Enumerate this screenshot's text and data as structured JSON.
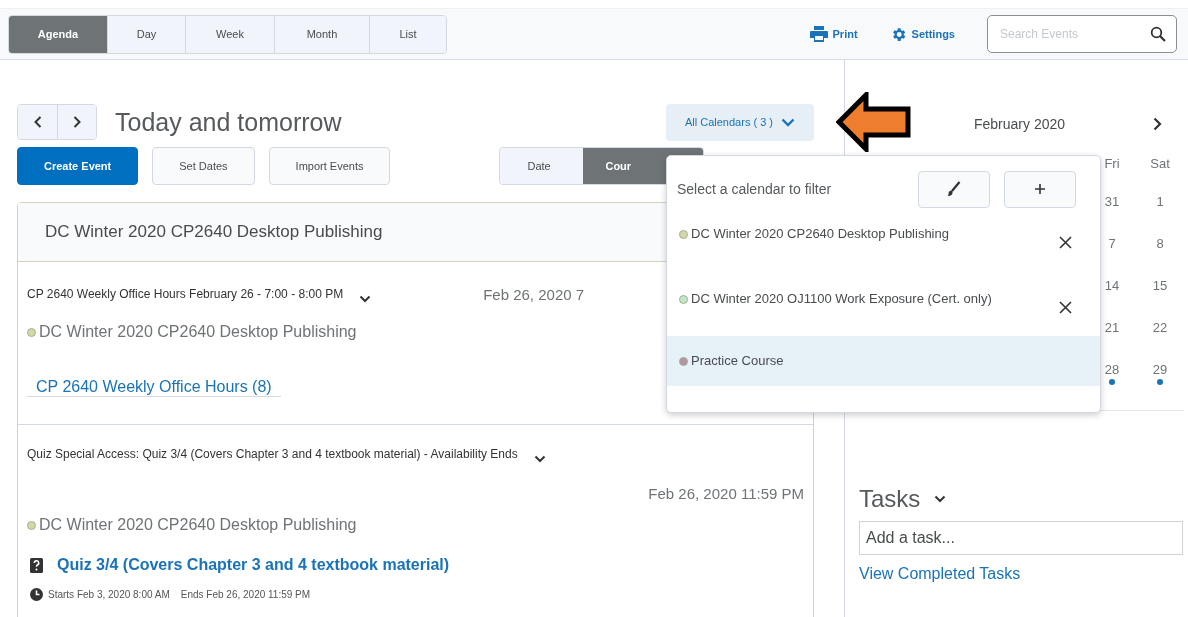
{
  "view_tabs": [
    {
      "label": "Agenda",
      "selected": true
    },
    {
      "label": "Day",
      "selected": false
    },
    {
      "label": "Week",
      "selected": false
    },
    {
      "label": "Month",
      "selected": false
    },
    {
      "label": "List",
      "selected": false
    }
  ],
  "toolbar": {
    "print": "Print",
    "settings": "Settings",
    "search_placeholder": "Search Events"
  },
  "heading": "Today and tomorrow",
  "calendars_button": "All Calendars ( 3 )",
  "actions": [
    {
      "label": "Create Event",
      "kind": "primary"
    },
    {
      "label": "Set Dates",
      "kind": "secondary"
    },
    {
      "label": "Import Events",
      "kind": "secondary"
    }
  ],
  "sort_tabs": [
    {
      "label": "Date",
      "selected": false
    },
    {
      "label": "Cour",
      "selected": true
    }
  ],
  "group": {
    "title": "DC Winter 2020 CP2640 Desktop Publishing",
    "events": [
      {
        "kind": "event",
        "title": "CP 2640 Weekly Office Hours February 26 - 7:00 - 8:00 PM",
        "date": "Feb 26, 2020 7",
        "calendar": "DC Winter 2020 CP2640 Desktop Publishing",
        "color": "#d4d9a3",
        "link": "CP 2640 Weekly Office Hours (8)"
      },
      {
        "kind": "quiz",
        "title": "Quiz Special Access: Quiz 3/4 (Covers Chapter 3 and 4 textbook material) - Availability Ends",
        "date": "Feb 26, 2020 11:59 PM",
        "calendar": "DC Winter 2020 CP2640 Desktop Publishing",
        "color": "#d4d9a3",
        "link": "Quiz 3/4 (Covers Chapter 3 and 4 textbook material)",
        "starts": "Starts Feb 3, 2020 8:00 AM",
        "ends": "Ends Feb 26, 2020 11:59 PM"
      }
    ]
  },
  "filter_popup": {
    "prompt": "Select a calendar to filter",
    "calendars": [
      {
        "name": "DC Winter 2020 CP2640 Desktop Publishing",
        "color": "#d4d9a3",
        "removable": true,
        "selected": false
      },
      {
        "name": "DC Winter 2020 OJ1100 Work Exposure (Cert. only)",
        "color": "#bfe8c6",
        "removable": true,
        "selected": false
      },
      {
        "name": "Practice Course",
        "color": "#b393a8",
        "removable": false,
        "selected": true
      }
    ]
  },
  "mini_calendar": {
    "month": "February 2020",
    "weekdays": [
      "Fri",
      "Sat"
    ],
    "weeks": [
      [
        {
          "day": "31",
          "has_events": false
        },
        {
          "day": "1",
          "has_events": false
        }
      ],
      [
        {
          "day": "7",
          "has_events": false
        },
        {
          "day": "8",
          "has_events": false
        }
      ],
      [
        {
          "day": "14",
          "has_events": false
        },
        {
          "day": "15",
          "has_events": false
        }
      ],
      [
        {
          "day": "21",
          "has_events": false
        },
        {
          "day": "22",
          "has_events": false
        }
      ],
      [
        {
          "day": "28",
          "has_events": true
        },
        {
          "day": "29",
          "has_events": true
        }
      ]
    ]
  },
  "tasks": {
    "title": "Tasks",
    "placeholder": "Add a task...",
    "link": "View Completed Tasks"
  }
}
